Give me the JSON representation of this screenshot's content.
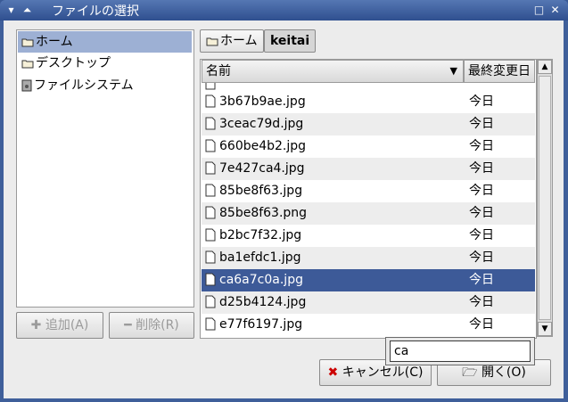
{
  "window": {
    "title": "ファイルの選択",
    "min_glyph": "▾",
    "shade_glyph": "⏶",
    "max_glyph": "□",
    "close_glyph": "✕"
  },
  "places": [
    {
      "label": "ホーム",
      "icon": "folder-icon",
      "selected": true
    },
    {
      "label": "デスクトップ",
      "icon": "folder-icon",
      "selected": false
    },
    {
      "label": "ファイルシステム",
      "icon": "drive-icon",
      "selected": false
    }
  ],
  "place_buttons": {
    "add": "追加(A)",
    "remove": "削除(R)"
  },
  "breadcrumbs": [
    {
      "label": "ホーム",
      "active": false
    },
    {
      "label": "keitai",
      "active": true
    }
  ],
  "file_list": {
    "col_name": "名前",
    "col_modified": "最終変更日",
    "rows": [
      {
        "name": "3b67b9ae.jpg",
        "date": "今日"
      },
      {
        "name": "3ceac79d.jpg",
        "date": "今日"
      },
      {
        "name": "660be4b2.jpg",
        "date": "今日"
      },
      {
        "name": "7e427ca4.jpg",
        "date": "今日"
      },
      {
        "name": "85be8f63.jpg",
        "date": "今日"
      },
      {
        "name": "85be8f63.png",
        "date": "今日"
      },
      {
        "name": "b2bc7f32.jpg",
        "date": "今日"
      },
      {
        "name": "ba1efdc1.jpg",
        "date": "今日"
      },
      {
        "name": "ca6a7c0a.jpg",
        "date": "今日",
        "selected": true
      },
      {
        "name": "d25b4124.jpg",
        "date": "今日"
      },
      {
        "name": "e77f6197.jpg",
        "date": "今日"
      }
    ]
  },
  "search": {
    "value": "ca"
  },
  "actions": {
    "cancel": "キャンセル(C)",
    "open": "開く(O)"
  },
  "colors": {
    "titlebar": "#3f5f9a",
    "selection": "#3d5a98",
    "place_selection": "#9db0d4"
  }
}
